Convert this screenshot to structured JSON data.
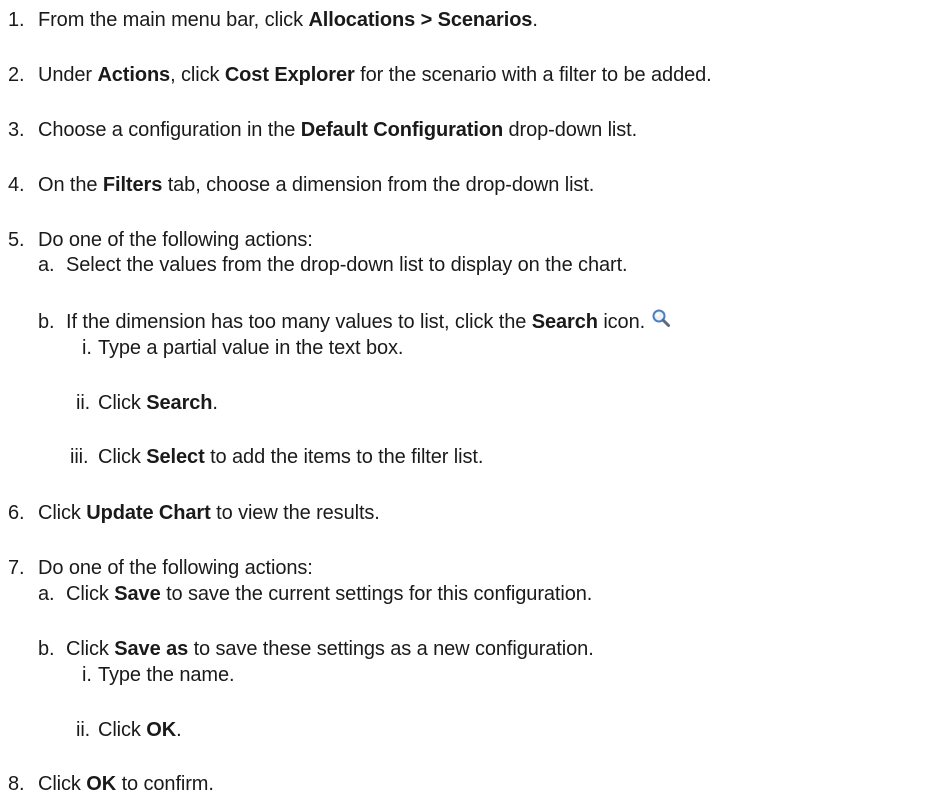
{
  "steps": [
    {
      "num": "1.",
      "t1": "From the main menu bar, click ",
      "b1": "Allocations > Scenarios",
      "t2": "."
    },
    {
      "num": "2.",
      "t1": "Under ",
      "b1": "Actions",
      "t2": ", click ",
      "b2": "Cost Explorer",
      "t3": " for the scenario with a filter to be added."
    },
    {
      "num": "3.",
      "t1": "Choose a configuration in the ",
      "b1": "Default Configuration",
      "t2": " drop-down list."
    },
    {
      "num": "4.",
      "t1": "On the ",
      "b1": "Filters",
      "t2": " tab, choose a dimension from the drop-down list."
    },
    {
      "num": "5.",
      "t1": "Do one of the following actions:",
      "a": {
        "num": "a.",
        "t1": "Select the values from the drop-down list to display on the chart."
      },
      "b": {
        "num": "b.",
        "t1": "If the dimension has too many values to list, click the ",
        "b1": "Search",
        "t2": " icon.",
        "i": {
          "num": "i.",
          "t1": "Type a partial value in the text box."
        },
        "ii": {
          "num": "ii.",
          "t1": "Click ",
          "b1": "Search",
          "t2": "."
        },
        "iii": {
          "num": "iii.",
          "t1": "Click ",
          "b1": "Select",
          "t2": " to add the items to the filter list."
        }
      }
    },
    {
      "num": "6.",
      "t1": "Click ",
      "b1": "Update Chart",
      "t2": " to view the results."
    },
    {
      "num": "7.",
      "t1": "Do one of the following actions:",
      "a": {
        "num": "a.",
        "t1": "Click ",
        "b1": "Save",
        "t2": " to save the current settings for this configuration."
      },
      "b": {
        "num": "b.",
        "t1": "Click ",
        "b1": "Save as",
        "t2": " to save these settings as a new configuration.",
        "i": {
          "num": "i.",
          "t1": "Type the name."
        },
        "ii": {
          "num": "ii.",
          "t1": "Click ",
          "b1": "OK",
          "t2": "."
        }
      }
    },
    {
      "num": "8.",
      "t1": "Click ",
      "b1": "OK",
      "t2": " to confirm."
    }
  ],
  "icons": {
    "search": "search-icon"
  },
  "colors": {
    "text": "#1a1a1a",
    "icon_blue": "#4a7fc1"
  }
}
